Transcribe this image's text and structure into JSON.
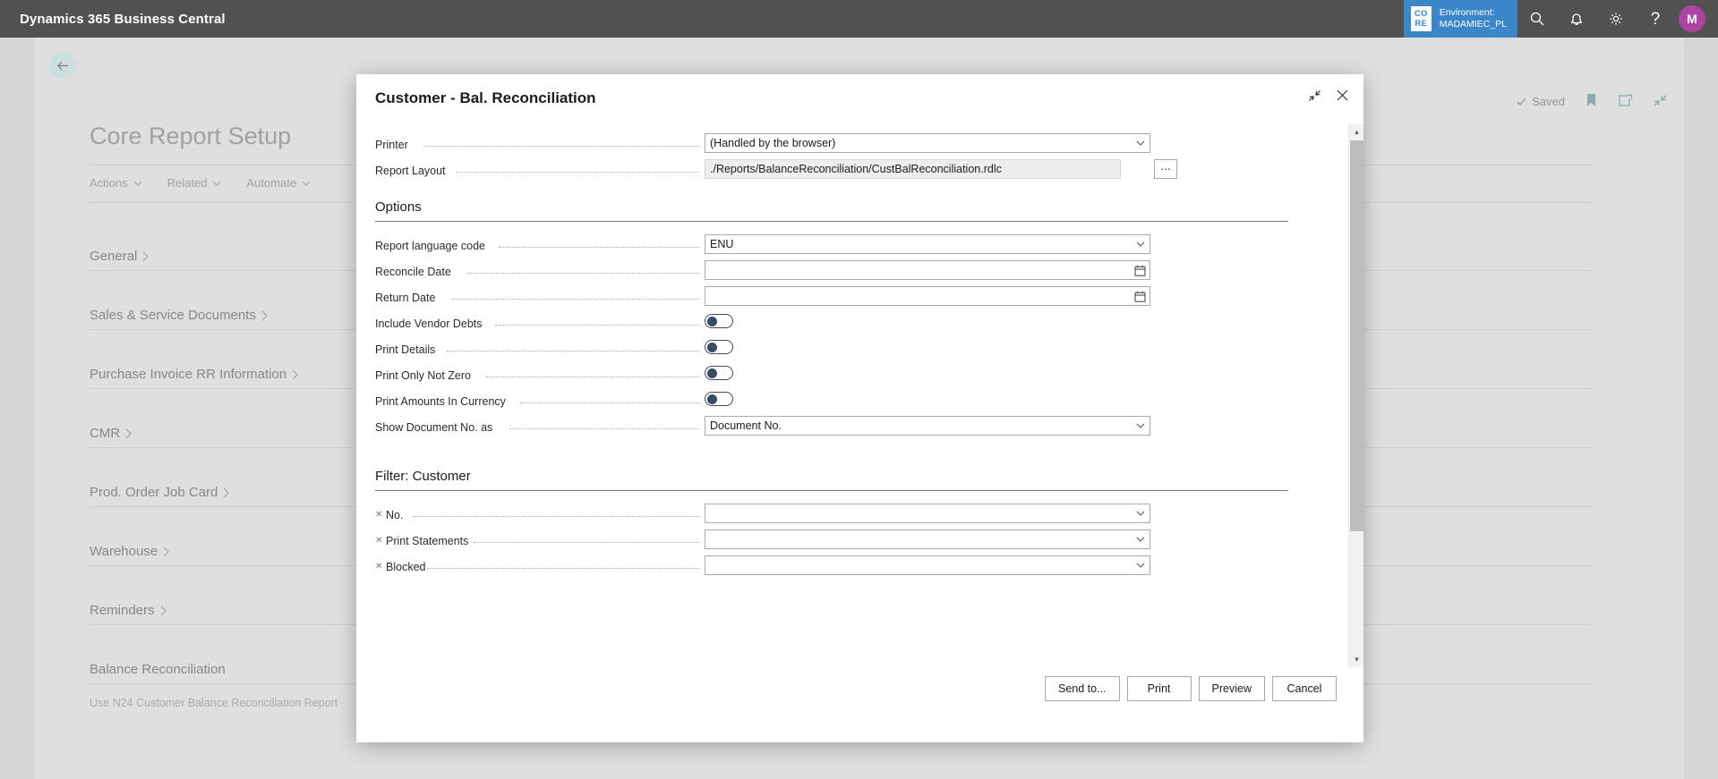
{
  "appbar": {
    "title": "Dynamics 365 Business Central",
    "env_logo_line1": "CO",
    "env_logo_line2": "RE",
    "env_label": "Environment:",
    "env_name": "MADAMIEC_PL",
    "avatar_initial": "M",
    "accent_blue": "#0f6cbd",
    "avatar_color": "#9b1b8f"
  },
  "page": {
    "title": "Core Report Setup",
    "actions": [
      {
        "label": "Actions"
      },
      {
        "label": "Related"
      },
      {
        "label": "Automate"
      }
    ],
    "saved_label": "Saved",
    "sections": [
      {
        "label": "General"
      },
      {
        "label": "Sales & Service Documents"
      },
      {
        "label": "Purchase Invoice RR Information"
      },
      {
        "label": "CMR"
      },
      {
        "label": "Prod. Order Job Card"
      },
      {
        "label": "Warehouse"
      },
      {
        "label": "Reminders"
      },
      {
        "label": "Balance Reconciliation"
      }
    ],
    "balance_field_label": "Use N24 Customer Balance Reconciliation Report"
  },
  "dialog": {
    "title": "Customer - Bal. Reconciliation",
    "top_fields": [
      {
        "label": "Printer",
        "value": "(Handled by the browser)",
        "control": "dropdown"
      },
      {
        "label": "Report Layout",
        "value": "./Reports/BalanceReconciliation/CustBalReconciliation.rdlc",
        "control": "readonly-assist"
      }
    ],
    "options": {
      "title": "Options",
      "fields": [
        {
          "label": "Report language code",
          "value": "ENU",
          "control": "dropdown"
        },
        {
          "label": "Reconcile Date",
          "value": "",
          "control": "date"
        },
        {
          "label": "Return Date",
          "value": "",
          "control": "date"
        },
        {
          "label": "Include Vendor Debts",
          "value": "off",
          "control": "toggle"
        },
        {
          "label": "Print Details",
          "value": "off",
          "control": "toggle"
        },
        {
          "label": "Print Only Not Zero",
          "value": "off",
          "control": "toggle"
        },
        {
          "label": "Print Amounts In Currency",
          "value": "off",
          "control": "toggle"
        },
        {
          "label": "Show Document No. as",
          "value": "Document No.",
          "control": "dropdown"
        }
      ]
    },
    "filter": {
      "title": "Filter: Customer",
      "fields": [
        {
          "label": "No.",
          "value": "",
          "control": "dropdown"
        },
        {
          "label": "Print Statements",
          "value": "",
          "control": "dropdown"
        },
        {
          "label": "Blocked",
          "value": "",
          "control": "dropdown"
        }
      ]
    },
    "buttons": [
      {
        "label": "Send to..."
      },
      {
        "label": "Print"
      },
      {
        "label": "Preview"
      },
      {
        "label": "Cancel"
      }
    ]
  }
}
